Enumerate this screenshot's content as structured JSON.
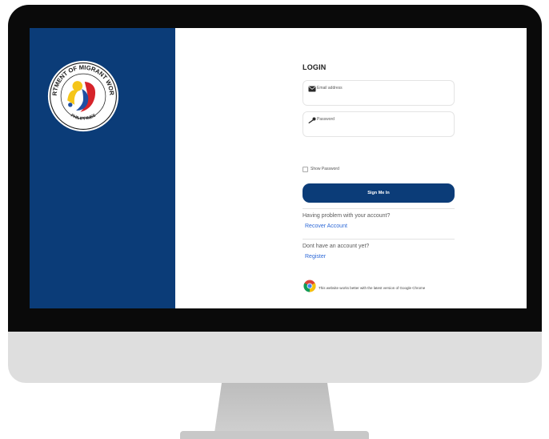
{
  "seal": {
    "top_text": "DEPARTMENT OF MIGRANT WORKERS",
    "bottom_text": "PHILIPPINES"
  },
  "login": {
    "title": "LOGIN",
    "email": {
      "label": "Email address",
      "icon": "envelope-icon",
      "value": ""
    },
    "password": {
      "label": "Password",
      "icon": "key-icon",
      "value": ""
    },
    "show_password_label": "Show Password",
    "show_password_checked": false,
    "sign_in_label": "Sign Me In"
  },
  "recover": {
    "question": "Having problem with your account?",
    "link": "Recover Account"
  },
  "register": {
    "question": "Dont have an account yet?",
    "link": "Register"
  },
  "browser_note": {
    "icon": "chrome-icon",
    "text": "This website works better with the latest version of Google Chrome"
  },
  "colors": {
    "brand": "#0b3c78",
    "link": "#2f6ad7",
    "bezel": "#0a0a0a",
    "chin": "#dedede"
  }
}
